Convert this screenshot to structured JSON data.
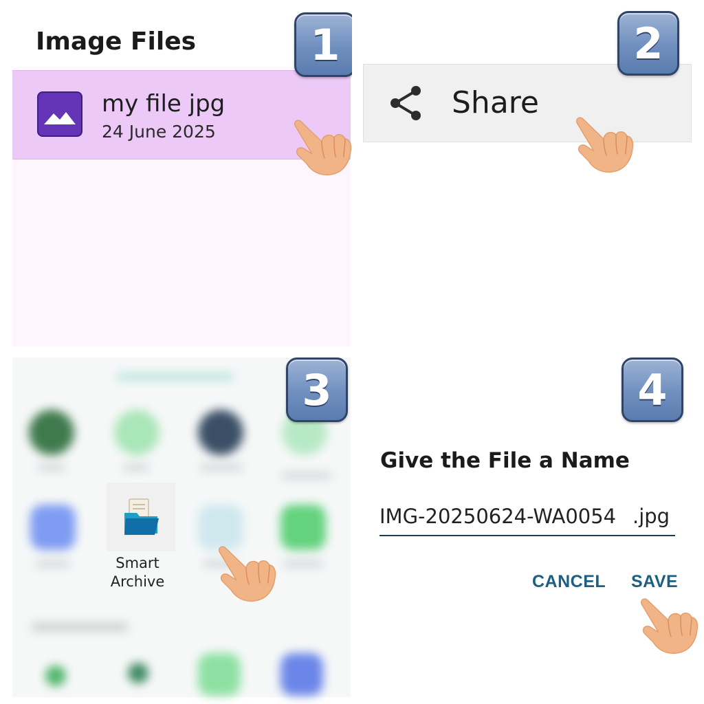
{
  "step1": {
    "badge": "1",
    "title": "Image Files",
    "file_name": "my file jpg",
    "file_date": "24 June 2025",
    "icon": "image-icon"
  },
  "step2": {
    "badge": "2",
    "share_label": "Share",
    "icon": "share-icon"
  },
  "step3": {
    "badge": "3",
    "app_label_line1": "Smart",
    "app_label_line2": "Archive",
    "icon": "folder-archive-icon"
  },
  "step4": {
    "badge": "4",
    "dialog_title": "Give the File a Name",
    "file_name_value": "IMG-20250624-WA0054",
    "extension": ".jpg",
    "cancel_label": "CANCEL",
    "save_label": "SAVE"
  },
  "colors": {
    "badge": "#6f8fbf",
    "selected_row": "#ecc9f7",
    "thumb": "#6334b5",
    "action_text": "#1b5f84",
    "hand": "#f0b487"
  }
}
